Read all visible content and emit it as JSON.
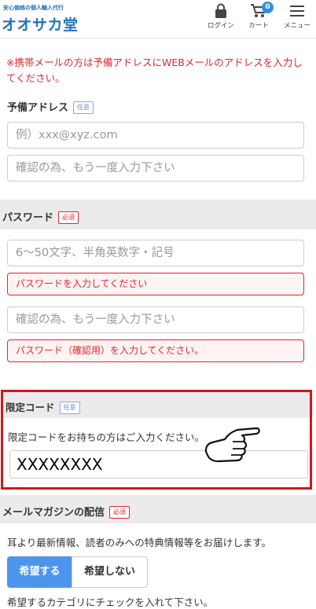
{
  "header": {
    "tagline": "安心価格の個人輸入代行",
    "logo": "オオサカ堂",
    "nav": [
      {
        "icon": "lock-icon",
        "label": "ログイン"
      },
      {
        "icon": "cart-icon",
        "label": "カート",
        "badge": "0"
      },
      {
        "icon": "menu-icon",
        "label": "メニュー"
      }
    ]
  },
  "notice": "※携帯メールの方は予備アドレスにWEBメールのアドレスを入力してください。",
  "backup_address": {
    "label": "予備アドレス",
    "tag": "任意",
    "placeholder": "例）xxx@xyz.com",
    "confirm_placeholder": "確認の為、もう一度入力下さい"
  },
  "password": {
    "label": "パスワード",
    "tag": "必須",
    "placeholder": "6〜50文字、半角英数字・記号",
    "error": "パスワードを入力してください",
    "confirm_placeholder": "確認の為、もう一度入力下さい",
    "confirm_error": "パスワード（確認用）を入力してください。"
  },
  "limited_code": {
    "label": "限定コード",
    "tag": "任意",
    "description": "限定コードをお持ちの方はご入力ください。",
    "value": "XXXXXXXX"
  },
  "newsletter": {
    "label": "メールマガジンの配信",
    "tag": "必須",
    "description": "耳より最新情報、読者のみへの特典情報等をお届けします。",
    "options": [
      "希望する",
      "希望しない"
    ],
    "selected": "希望する",
    "category_note": "希望するカテゴリにチェックを入れて下さい。"
  },
  "colors": {
    "accent": "#1e73be",
    "required": "#e4242b",
    "selected": "#4d95ec",
    "highlight": "#d6141f"
  }
}
